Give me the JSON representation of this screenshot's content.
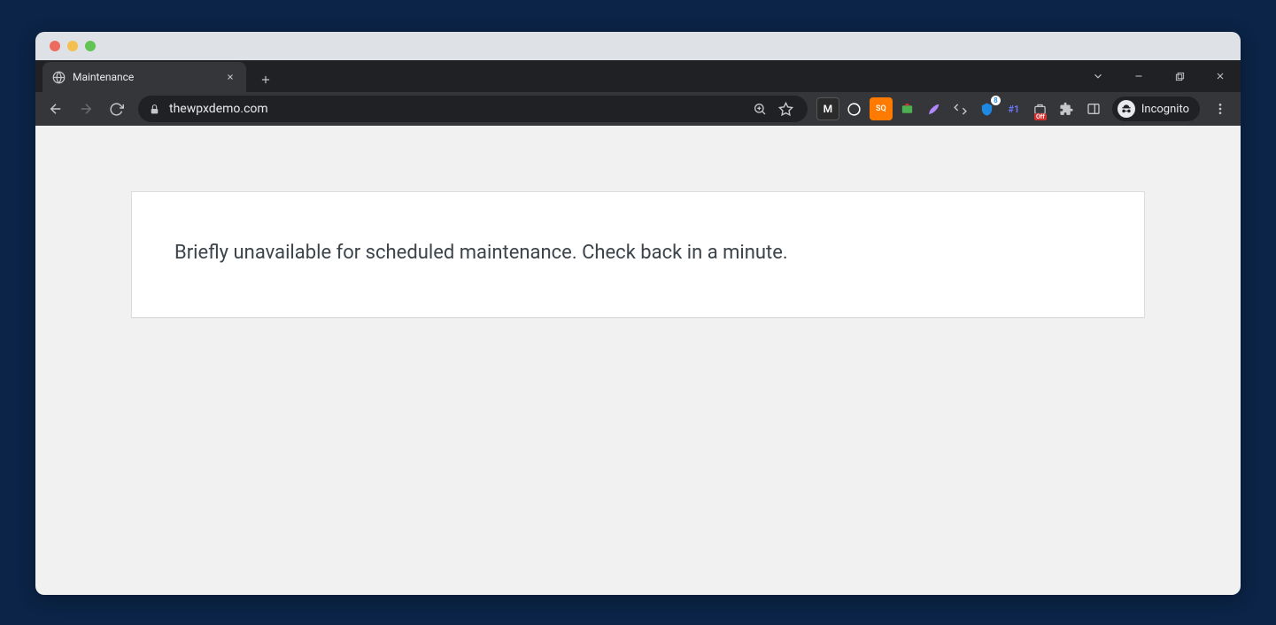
{
  "tab": {
    "title": "Maintenance"
  },
  "omnibox": {
    "url": "thewpxdemo.com"
  },
  "incognito": {
    "label": "Incognito"
  },
  "extensions": {
    "hash_label": "#1",
    "off_label": "Off",
    "sq_label": "SQ",
    "m_label": "M",
    "blue_badge": "8"
  },
  "page": {
    "message": "Briefly unavailable for scheduled maintenance. Check back in a minute."
  }
}
